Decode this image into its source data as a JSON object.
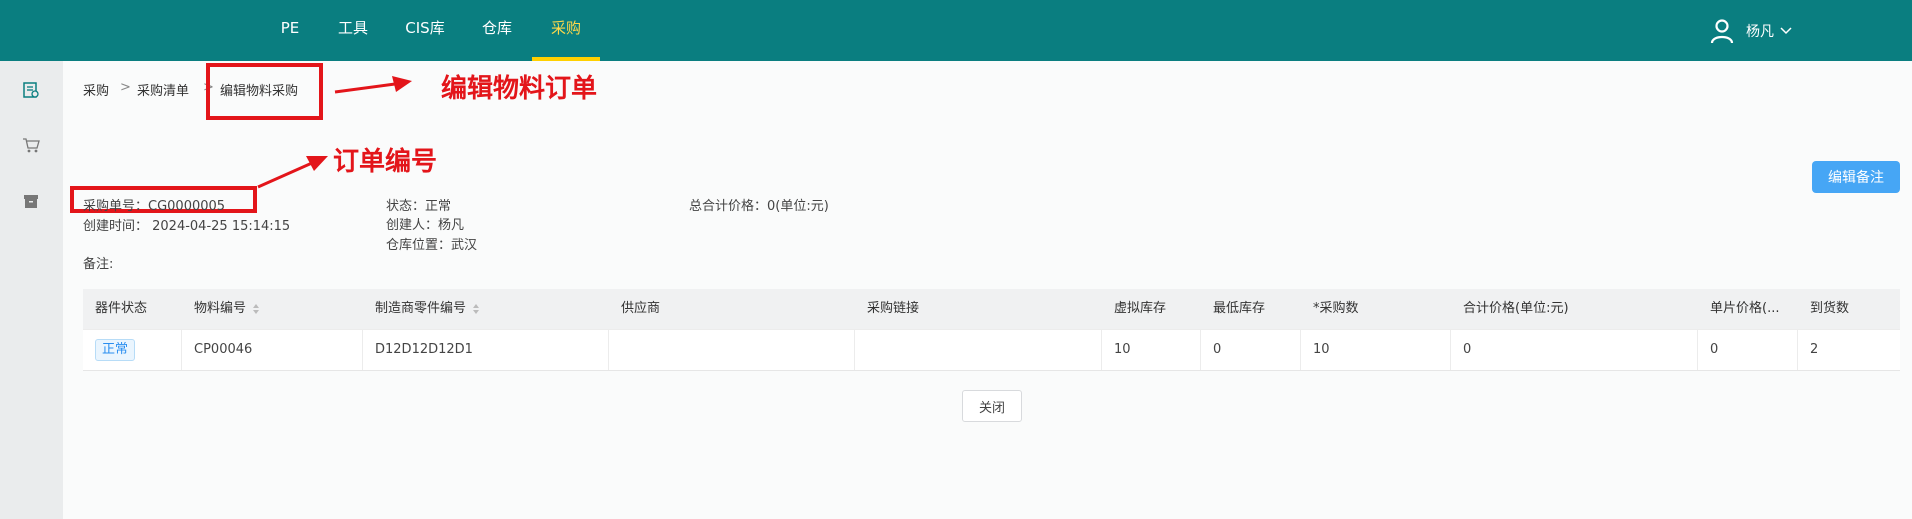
{
  "nav": {
    "items": [
      {
        "label": "PE"
      },
      {
        "label": "工具"
      },
      {
        "label": "CIS库"
      },
      {
        "label": "仓库"
      },
      {
        "label": "采购"
      }
    ],
    "active": "采购",
    "user": "杨凡"
  },
  "sidebar": {
    "icons": [
      "document-icon",
      "cart-icon",
      "archive-icon"
    ]
  },
  "breadcrumb": {
    "items": [
      "采购",
      "采购清单",
      "编辑物料采购"
    ],
    "separator": ">"
  },
  "annotations": {
    "edit_label": "编辑物料订单",
    "order_no_label": "订单编号"
  },
  "info": {
    "order_no": "采购单号：CG0000005",
    "created_time": "创建时间：  2024-04-25 15:14:15",
    "remark": "备注:",
    "status": "状态：正常",
    "creator": "创建人：杨凡",
    "warehouse": "仓库位置：武汉",
    "total_price": "总合计价格：0(单位:元)"
  },
  "buttons": {
    "edit_remark": "编辑备注",
    "close": "关闭"
  },
  "table": {
    "headers": [
      "器件状态",
      "物料编号",
      "制造商零件编号",
      "供应商",
      "采购链接",
      "虚拟库存",
      "最低库存",
      "*采购数",
      "合计价格(单位:元)",
      "单片价格(...",
      "到货数"
    ],
    "rows": [
      [
        "正常",
        "CP00046",
        "D12D12D12D1",
        "",
        "",
        "10",
        "0",
        "10",
        "0",
        "0",
        "2"
      ]
    ]
  },
  "colors": {
    "topbar": "#0a7e80",
    "active_nav": "#ffd84a",
    "annotation": "#e3151a",
    "primary_button": "#46a6f5"
  }
}
